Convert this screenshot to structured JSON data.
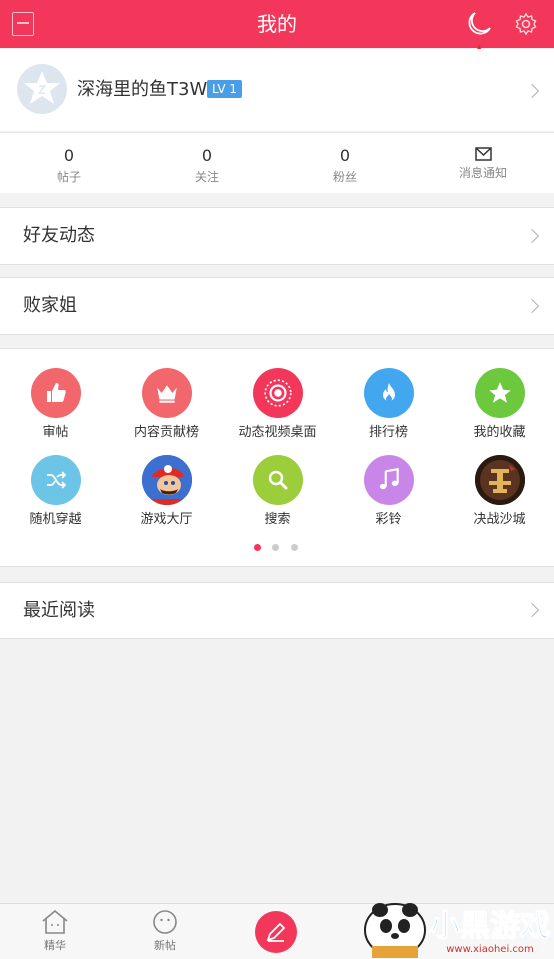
{
  "header": {
    "title": "我的",
    "bg_color": "#f2375b"
  },
  "profile": {
    "username": "深海里的鱼T3W",
    "level": "LV 1"
  },
  "stats": [
    {
      "value": "0",
      "label": "帖子"
    },
    {
      "value": "0",
      "label": "关注"
    },
    {
      "value": "0",
      "label": "粉丝"
    },
    {
      "label": "消息通知",
      "icon": "mail-icon"
    }
  ],
  "rows": {
    "friends": "好友动态",
    "baijiajie": "败家姐",
    "recent": "最近阅读"
  },
  "grid": {
    "items": [
      {
        "label": "审帖",
        "icon": "thumbs-up-icon",
        "color": "#f2676c"
      },
      {
        "label": "内容贡献榜",
        "icon": "crown-icon",
        "color": "#f2676c"
      },
      {
        "label": "动态视频桌面",
        "icon": "record-icon",
        "color": "#f2375b"
      },
      {
        "label": "排行榜",
        "icon": "flame-icon",
        "color": "#42a7ef"
      },
      {
        "label": "我的收藏",
        "icon": "star-icon",
        "color": "#6cc83c"
      },
      {
        "label": "随机穿越",
        "icon": "shuffle-icon",
        "color": "#6cc4e6"
      },
      {
        "label": "游戏大厅",
        "icon": "mario-avatar-icon",
        "color": "#2d5fbf"
      },
      {
        "label": "搜索",
        "icon": "search-icon",
        "color": "#9ccd3b"
      },
      {
        "label": "彩铃",
        "icon": "music-note-icon",
        "color": "#c887e8"
      },
      {
        "label": "决战沙城",
        "icon": "dragon-game-icon",
        "color": "#3a2416"
      }
    ],
    "page_indicator": {
      "count": 3,
      "active": 1
    }
  },
  "tabbar": [
    {
      "label": "精华",
      "icon": "house-icon"
    },
    {
      "label": "新帖",
      "icon": "smiley-icon"
    },
    {
      "label": "",
      "icon": "pencil-compose-icon"
    }
  ],
  "watermark": {
    "title": "小黑游戏",
    "url": "www.xiaohei.com"
  }
}
